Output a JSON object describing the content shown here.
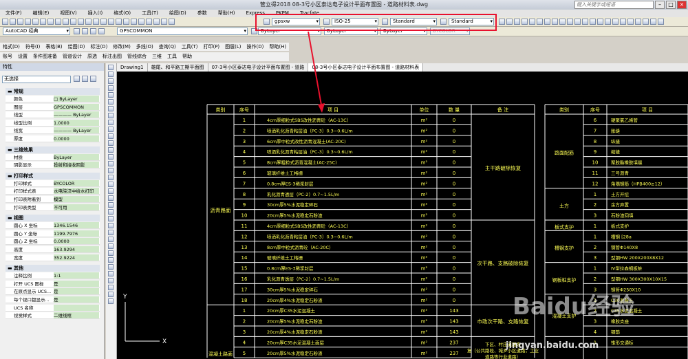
{
  "window": {
    "title": "管立得2018    08-3号小区泰达电子设计平面布置图 - 道路材料表.dwg",
    "search_placeholder": "键入关键字或短语"
  },
  "menubar": [
    "文件(F)",
    "编辑(E)",
    "视图(V)",
    "插入(I)",
    "格式(O)",
    "工具(T)",
    "绘图(D)",
    "参数",
    "帮助(H)",
    "Express",
    "PKPM",
    "Tracfate"
  ],
  "toolbar": {
    "workspace": "AutoCAD 经典",
    "layer": "GPSCOMMON",
    "text_style": "gpsxw",
    "dim_style": "ISO-25",
    "table_style": "Standard",
    "mleader_style": "Standard",
    "color": "ByLayer",
    "linetype": "ByLayer",
    "lineweight": "ByLayer",
    "plotstyle": "BYCOLOR"
  },
  "menu2": [
    "格式(D)",
    "符号(I)",
    "表格(B)",
    "绘图(D)",
    "标注(D)",
    "修改(M)",
    "多线(O)",
    "查询(Q)",
    "工具(T)",
    "打印(P)",
    "图层(L)",
    "操作(D)",
    "帮助(H)"
  ],
  "menu3": [
    "账号",
    "设置",
    "条件图准备",
    "管道设计",
    "原选",
    "标注出图",
    "管线综合",
    "三维",
    "工具",
    "帮助"
  ],
  "props": {
    "title": "特性",
    "selection": "无选择",
    "sections": [
      {
        "name": "常规",
        "rows": [
          [
            "颜色",
            "□ ByLayer"
          ],
          [
            "图层",
            "GPSCOMMON"
          ],
          [
            "线型",
            "———— ByLayer"
          ],
          [
            "线型比例",
            "1.0000"
          ],
          [
            "线宽",
            "———— ByLayer"
          ],
          [
            "厚度",
            "0.0000"
          ]
        ]
      },
      {
        "name": "三维效果",
        "rows": [
          [
            "材质",
            "ByLayer"
          ],
          [
            "阴影显示",
            "投射和接收阴影"
          ]
        ]
      },
      {
        "name": "打印样式",
        "rows": [
          [
            "打印样式",
            "BYCOLOR"
          ],
          [
            "打印样式表",
            "水电院汉中给水打印"
          ],
          [
            "打印表附着到",
            "模型"
          ],
          [
            "打印表类型",
            "不可用"
          ]
        ]
      },
      {
        "name": "视图",
        "rows": [
          [
            "圆心 X 坐标",
            "1346.1546"
          ],
          [
            "圆心 Y 坐标",
            "1199.7976"
          ],
          [
            "圆心 Z 坐标",
            "0.0000"
          ],
          [
            "高度",
            "163.9294"
          ],
          [
            "宽度",
            "352.9224"
          ]
        ]
      },
      {
        "name": "其他",
        "rows": [
          [
            "注释比例",
            "1:1"
          ],
          [
            "打开 UCS 图标",
            "是"
          ],
          [
            "在原点显示 UCS...",
            "是"
          ],
          [
            "每个视口都显示...",
            "是"
          ],
          [
            "UCS 名称",
            ""
          ],
          [
            "视觉样式",
            "二维线框"
          ]
        ]
      }
    ]
  },
  "doctabs": [
    "Drawing1",
    "雄尾、和平路工期平面图",
    "07-3号小区泰达电子设计平面布置图 - 道路",
    "08-3号小区泰达电子设计平面布置图 - 道路材料表"
  ],
  "table_left": {
    "headers": [
      "类别",
      "序号",
      "项    目",
      "单位",
      "数 量",
      "备 注"
    ],
    "rows": [
      [
        "1",
        "4cm厚细粒式SBS改性沥青砼（AC-13C）",
        "m²",
        "0"
      ],
      [
        "2",
        "喷洒乳化沥青粘层油（PC-3）0.3~0.6L/m",
        "m²",
        "0"
      ],
      [
        "3",
        "6cm厚中粒式改性沥青混凝土(AC-20C)",
        "m²",
        "0"
      ],
      [
        "4",
        "喷洒乳化沥青粘层油（PC-3）0.3~0.6L/m",
        "m²",
        "0"
      ],
      [
        "5",
        "8cm厚粗粒式沥青混凝土(AC-25C)",
        "m²",
        "0"
      ],
      [
        "6",
        "玻璃纤维土工格栅",
        "m²",
        "0"
      ],
      [
        "7",
        "0.8cm厚ES-3稀浆封层",
        "m²",
        "0"
      ],
      [
        "8",
        "乳化沥青透层（PC-2）0.7~1.5L/m",
        "m²",
        "0"
      ],
      [
        "9",
        "30cm厚5%水泥稳定碎石",
        "m²",
        "0"
      ],
      [
        "10",
        "20cm厚5%水泥稳定石粉渣",
        "m²",
        "0"
      ],
      [
        "11",
        "4cm厚细粒式SBS改性沥青砼（AC-13C）",
        "m²",
        "0"
      ],
      [
        "12",
        "喷洒乳化沥青粘层油（PC-3）0.3~0.6L/m",
        "m²",
        "0"
      ],
      [
        "13",
        "8cm厚中粒式沥青砼（AC-20C）",
        "m²",
        "0"
      ],
      [
        "14",
        "玻璃纤维土工格栅",
        "m²",
        "0"
      ],
      [
        "15",
        "0.8cm厚ES-3稀浆封层",
        "m²",
        "0"
      ],
      [
        "16",
        "乳化沥青透层（PC-2）0.7~1.5L/m",
        "m²",
        "0"
      ],
      [
        "17",
        "30cm厚5%水泥稳定碎石",
        "m²",
        "0"
      ],
      [
        "18",
        "20cm厚4%水泥稳定石粉渣",
        "m²",
        "0"
      ],
      [
        "1",
        "20cm厚C35水泥混凝土",
        "m²",
        "143"
      ],
      [
        "2",
        "20cm厚5%水泥稳定石粉渣",
        "m²",
        "143"
      ],
      [
        "3",
        "20cm厚4%水泥稳定石粉渣",
        "m²",
        "143"
      ],
      [
        "4",
        "20cm厚C35水泥混凝土面层",
        "m²",
        "237"
      ],
      [
        "5",
        "20cm厚5%水泥稳定石粉渣",
        "m²",
        "237"
      ]
    ],
    "category_asphalt": "沥青路面",
    "category_bottom": "混凝土路面",
    "note_main": "主干路破除恢复",
    "note_secondary": "次干路、支路破除恢复",
    "note_civic": "市政次干路、支路恢复",
    "note_village": "下区、村庄道路恢复（公共路段、城乡小区道路，工业道路等行业道路）"
  },
  "table_right": {
    "headers": [
      "类别",
      "序号",
      "项    目"
    ],
    "rows": [
      [
        "6",
        "硬聚氯乙烯管"
      ],
      [
        "7",
        "胀缝"
      ],
      [
        "8",
        "纵缝"
      ],
      [
        "9",
        "缩缝"
      ],
      [
        "10",
        "聚胶酯橡胶填缝"
      ],
      [
        "11",
        "三号沥青"
      ],
      [
        "12",
        "角隅钢筋（HPB400≥12）"
      ],
      [
        "1",
        "土方开挖"
      ],
      [
        "2",
        "余方弃置"
      ],
      [
        "3",
        "石粉渣回填"
      ],
      [
        "1",
        "板式支护"
      ],
      [
        "1",
        "槽钢 [28a"
      ],
      [
        "2",
        "钢管Φ140X8"
      ],
      [
        "3",
        "型钢HW 200X200X8X12"
      ],
      [
        "1",
        "IV型拉森钢板桩"
      ],
      [
        "2",
        "型钢HW 300X300X10X15"
      ],
      [
        "3",
        "钢管Φ250X10"
      ],
      [
        "1",
        "C30混凝土"
      ],
      [
        "2",
        "C35水泥混凝土"
      ],
      [
        "3",
        "橡胶支座"
      ],
      [
        "4",
        "钢筋"
      ],
      [
        "1",
        "锥形交通标"
      ]
    ],
    "cat_joints": "路面配筋",
    "cat_earth": "土方",
    "cat_board": "板式支护",
    "cat_channel": "槽钢支护",
    "cat_sheet": "钢板桩支护",
    "cat_concrete": "混凝土支护"
  },
  "watermark": {
    "logo": "Baidu经验",
    "url": "jingyan.baidu.com"
  },
  "ucs": {
    "x": "X",
    "y": "Y"
  },
  "colors": {
    "accent": "#e8112d",
    "canvas": "#000000",
    "table_text": "#ffff55",
    "table_lines": "#ffffff"
  }
}
